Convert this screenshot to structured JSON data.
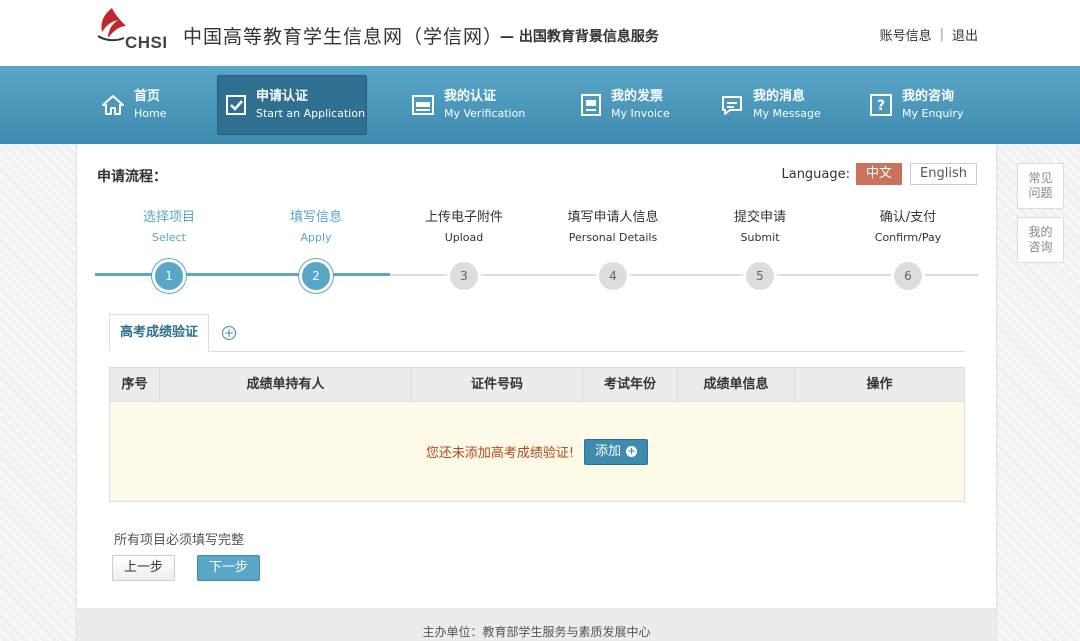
{
  "header": {
    "logo_text": "CHSI",
    "title": "中国高等教育学生信息网（学信网）",
    "subtitle": "— 出国教育背景信息服务",
    "account": "账号信息",
    "separator": "|",
    "logout": "退出"
  },
  "nav": [
    {
      "cn": "首页",
      "en": "Home",
      "icon": "home-icon"
    },
    {
      "cn": "申请认证",
      "en": "Start an Application",
      "icon": "checkbox-icon",
      "active": true
    },
    {
      "cn": "我的认证",
      "en": "My Verification",
      "icon": "verification-icon"
    },
    {
      "cn": "我的发票",
      "en": "My Invoice",
      "icon": "invoice-icon"
    },
    {
      "cn": "我的消息",
      "en": "My Message",
      "icon": "message-icon"
    },
    {
      "cn": "我的咨询",
      "en": "My Enquiry",
      "icon": "question-icon"
    }
  ],
  "flow": {
    "title": "申请流程：",
    "language_label": "Language:",
    "lang_cn": "中文",
    "lang_en": "English",
    "steps": [
      {
        "cn": "选择项目",
        "en": "Select",
        "num": "1",
        "done": true
      },
      {
        "cn": "填写信息",
        "en": "Apply",
        "num": "2",
        "done": true
      },
      {
        "cn": "上传电子附件",
        "en": "Upload",
        "num": "3"
      },
      {
        "cn": "填写申请人信息",
        "en": "Personal Details",
        "num": "4"
      },
      {
        "cn": "提交申请",
        "en": "Submit",
        "num": "5"
      },
      {
        "cn": "确认/支付",
        "en": "Confirm/Pay",
        "num": "6"
      }
    ]
  },
  "tab": {
    "label": "高考成绩验证",
    "add_symbol": "+"
  },
  "table": {
    "headers": [
      "序号",
      "成绩单持有人",
      "证件号码",
      "考试年份",
      "成绩单信息",
      "操作"
    ],
    "empty_message": "您还未添加高考成绩验证!",
    "add_label": "添加",
    "add_plus": "+"
  },
  "form": {
    "hint": "所有项目必须填写完整",
    "prev_label": "上一步",
    "next_label": "下一步"
  },
  "footer": {
    "text": "主办单位：教育部学生服务与素质发展中心"
  },
  "side": {
    "faq_line1": "常见",
    "faq_line2": "问题",
    "enquiry_line1": "我的",
    "enquiry_line2": "咨询"
  },
  "colors": {
    "nav_bg": "#4a98bd",
    "accent": "#5aa6c8",
    "lang_active": "#c9735d",
    "warning_text": "#b1461f",
    "table_empty_bg": "#fdfbe7"
  }
}
